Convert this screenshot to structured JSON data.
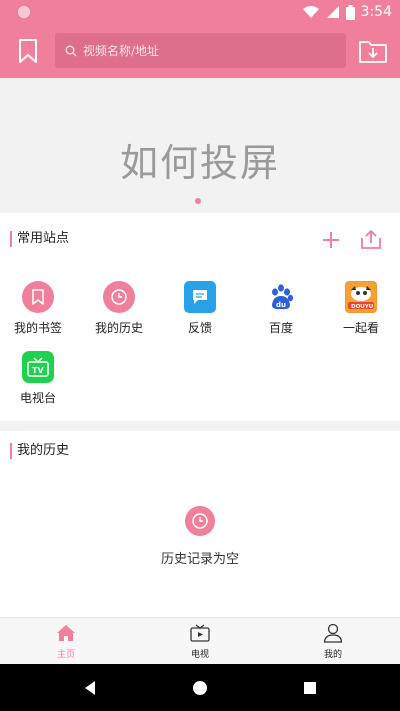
{
  "status_bar": {
    "time": "3:54"
  },
  "app_bar": {
    "search_placeholder": "视频名称/地址",
    "bookmark_icon": "bookmark-icon",
    "download_icon": "download-folder-icon"
  },
  "banner": {
    "title": "如何投屏"
  },
  "sites": {
    "title": "常用站点",
    "items": [
      {
        "label": "我的书签",
        "icon": "bookmark-icon"
      },
      {
        "label": "我的历史",
        "icon": "clock-icon"
      },
      {
        "label": "反馈",
        "icon": "chat-icon"
      },
      {
        "label": "百度",
        "icon": "baidu-paw-icon"
      },
      {
        "label": "一起看",
        "icon": "douyu-logo-icon"
      },
      {
        "label": "电视台",
        "icon": "tv-icon"
      }
    ]
  },
  "history": {
    "title": "我的历史",
    "empty_text": "历史记录为空"
  },
  "bottom_nav": {
    "items": [
      {
        "label": "主页",
        "icon": "home-icon",
        "active": true
      },
      {
        "label": "电视",
        "icon": "tv-play-icon",
        "active": false
      },
      {
        "label": "我的",
        "icon": "person-icon",
        "active": false
      }
    ]
  },
  "colors": {
    "accent": "#f07f9c",
    "background": "#f2f2f2"
  }
}
